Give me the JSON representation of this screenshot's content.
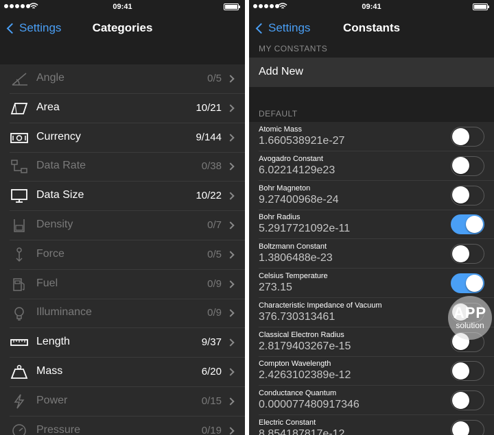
{
  "left_screen": {
    "status": {
      "time": "09:41"
    },
    "nav": {
      "back_label": "Settings",
      "title": "Categories"
    },
    "categories": [
      {
        "name": "Angle",
        "count": "0/5",
        "icon": "angle-icon",
        "enabled": false
      },
      {
        "name": "Area",
        "count": "10/21",
        "icon": "area-icon",
        "enabled": true
      },
      {
        "name": "Currency",
        "count": "9/144",
        "icon": "currency-icon",
        "enabled": true
      },
      {
        "name": "Data Rate",
        "count": "0/38",
        "icon": "data-rate-icon",
        "enabled": false
      },
      {
        "name": "Data Size",
        "count": "10/22",
        "icon": "data-size-icon",
        "enabled": true
      },
      {
        "name": "Density",
        "count": "0/7",
        "icon": "density-icon",
        "enabled": false
      },
      {
        "name": "Force",
        "count": "0/5",
        "icon": "force-icon",
        "enabled": false
      },
      {
        "name": "Fuel",
        "count": "0/9",
        "icon": "fuel-icon",
        "enabled": false
      },
      {
        "name": "Illuminance",
        "count": "0/9",
        "icon": "illuminance-icon",
        "enabled": false
      },
      {
        "name": "Length",
        "count": "9/37",
        "icon": "length-icon",
        "enabled": true
      },
      {
        "name": "Mass",
        "count": "6/20",
        "icon": "mass-icon",
        "enabled": true
      },
      {
        "name": "Power",
        "count": "0/15",
        "icon": "power-icon",
        "enabled": false
      },
      {
        "name": "Pressure",
        "count": "0/19",
        "icon": "pressure-icon",
        "enabled": false
      }
    ]
  },
  "right_screen": {
    "status": {
      "time": "09:41"
    },
    "nav": {
      "back_label": "Settings",
      "title": "Constants"
    },
    "my_constants_header": "MY CONSTANTS",
    "add_new_label": "Add New",
    "default_header": "DEFAULT",
    "constants": [
      {
        "name": "Atomic Mass",
        "value": "1.660538921e-27",
        "on": false
      },
      {
        "name": "Avogadro Constant",
        "value": "6.02214129e23",
        "on": false
      },
      {
        "name": "Bohr Magneton",
        "value": "9.27400968e-24",
        "on": false
      },
      {
        "name": "Bohr Radius",
        "value": "5.2917721092e-11",
        "on": true
      },
      {
        "name": "Boltzmann Constant",
        "value": "1.3806488e-23",
        "on": false
      },
      {
        "name": "Celsius Temperature",
        "value": "273.15",
        "on": true
      },
      {
        "name": "Characteristic Impedance of Vacuum",
        "value": "376.730313461",
        "on": false
      },
      {
        "name": "Classical Electron Radius",
        "value": "2.8179403267e-15",
        "on": false
      },
      {
        "name": "Compton Wavelength",
        "value": "2.4263102389e-12",
        "on": false
      },
      {
        "name": "Conductance Quantum",
        "value": "0.000077480917346",
        "on": false
      },
      {
        "name": "Electric Constant",
        "value": "8.854187817e-12",
        "on": false
      }
    ]
  },
  "watermark": {
    "line1": "APP",
    "line2": "solution"
  },
  "colors": {
    "accent": "#4a9ff5",
    "background": "#2b2b2b",
    "bar": "#1f1f1f"
  }
}
